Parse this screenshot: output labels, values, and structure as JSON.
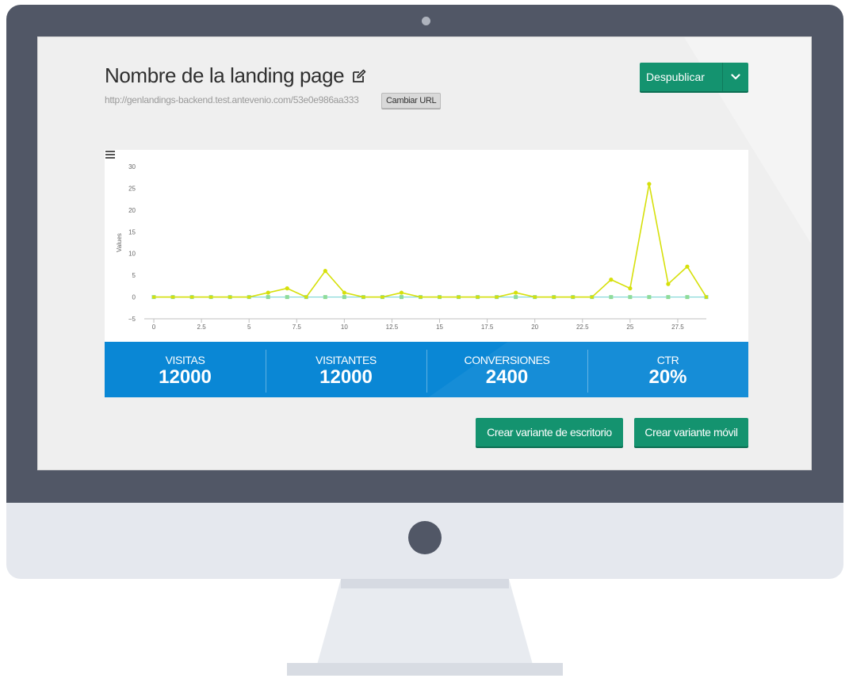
{
  "header": {
    "title": "Nombre de la landing page",
    "url": "http://genlandings-backend.test.antevenio.com/53e0e986aa333",
    "change_url_label": "Cambiar URL",
    "unpublish_label": "Despublicar"
  },
  "chart_data": {
    "type": "line",
    "ylabel": "Values",
    "xlabel": "",
    "xlim": [
      -0.5,
      29
    ],
    "ylim": [
      -5,
      30
    ],
    "x_ticks": [
      "0",
      "2.5",
      "5",
      "7.5",
      "10",
      "12.5",
      "15",
      "17.5",
      "20",
      "22.5",
      "25",
      "27.5"
    ],
    "x_tick_values": [
      0,
      2.5,
      5,
      7.5,
      10,
      12.5,
      15,
      17.5,
      20,
      22.5,
      25,
      27.5
    ],
    "y_ticks": [
      "30",
      "25",
      "20",
      "15",
      "10",
      "5",
      "0",
      "−5"
    ],
    "y_tick_values": [
      30,
      25,
      20,
      15,
      10,
      5,
      0,
      -5
    ],
    "series": [
      {
        "color": "#d6e00a",
        "x": [
          0,
          1,
          2,
          3,
          4,
          5,
          6,
          7,
          8,
          9,
          10,
          11,
          12,
          13,
          14,
          15,
          16,
          17,
          18,
          19,
          20,
          21,
          22,
          23,
          24,
          25,
          26,
          27,
          28,
          29
        ],
        "values": [
          0,
          0,
          0,
          0,
          0,
          0,
          1,
          2,
          0,
          6,
          1,
          0,
          0,
          1,
          0,
          0,
          0,
          0,
          0,
          1,
          0,
          0,
          0,
          0,
          4,
          2,
          26,
          3,
          7,
          0
        ]
      },
      {
        "color": "#7ed6d6",
        "x": [
          0,
          1,
          2,
          3,
          4,
          5,
          6,
          7,
          8,
          9,
          10,
          11,
          12,
          13,
          14,
          15,
          16,
          17,
          18,
          19,
          20,
          21,
          22,
          23,
          24,
          25,
          26,
          27,
          28,
          29
        ],
        "values": [
          0,
          0,
          0,
          0,
          0,
          0,
          0,
          0,
          0,
          0,
          0,
          0,
          0,
          0,
          0,
          0,
          0,
          0,
          0,
          0,
          0,
          0,
          0,
          0,
          0,
          0,
          0,
          0,
          0,
          0
        ]
      }
    ],
    "grid": false,
    "legend": "none"
  },
  "stats": [
    {
      "label": "VISITAS",
      "value": "12000"
    },
    {
      "label": "VISITANTES",
      "value": "12000"
    },
    {
      "label": "CONVERSIONES",
      "value": "2400"
    },
    {
      "label": "CTR",
      "value": "20%"
    }
  ],
  "actions": {
    "desktop_variant_label": "Crear variante de escritorio",
    "mobile_variant_label": "Crear variante móvil"
  },
  "colors": {
    "accent": "#14936f",
    "stats_bar": "#0a87d5",
    "monitor": "#515766"
  },
  "icons": {
    "edit": "edit-icon",
    "chevron": "chevron-down-icon",
    "chart_menu": "menu-icon"
  }
}
